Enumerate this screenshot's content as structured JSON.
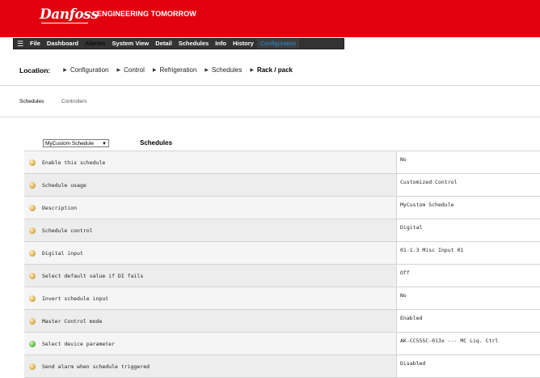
{
  "header": {
    "brand": "Danfoss",
    "tagline": "ENGINEERING TOMORROW",
    "brand_color": "#e2000f"
  },
  "menu": {
    "icon": "hamburger-menu-icon",
    "items": [
      "File",
      "Dashboard",
      "Alarms",
      "System View",
      "Detail",
      "Schedules",
      "Info",
      "History",
      "Configuration"
    ],
    "active": "Configuration"
  },
  "location": {
    "label": "Location:",
    "items": [
      "Configuration",
      "Control",
      "Refrigeration",
      "Schedules",
      "Rack / pack"
    ]
  },
  "subtabs": [
    "Schedules",
    "Controllers"
  ],
  "schedule_select": {
    "value": "MyCustom Schedule"
  },
  "section_title": "Schedules",
  "rows": [
    {
      "label": "Enable this schedule",
      "value": "No",
      "icon": "status-icon"
    },
    {
      "label": "Schedule usage",
      "value": "Customized Control",
      "icon": "status-icon"
    },
    {
      "label": "Description",
      "value": "MyCustom Schedule",
      "icon": "status-icon"
    },
    {
      "label": "Schedule control",
      "value": "Digital",
      "icon": "status-icon"
    },
    {
      "label": "Digital input",
      "value": "01-1.3 Misc Input 01",
      "icon": "status-icon"
    },
    {
      "label": "Select default value if DI fails",
      "value": "Off",
      "icon": "status-icon"
    },
    {
      "label": "Invert schedule input",
      "value": "No",
      "icon": "status-icon"
    },
    {
      "label": "Master Control mode",
      "value": "Enabled",
      "icon": "status-icon"
    },
    {
      "label": "Select device parameter",
      "value": "AK-CC55SC-013x --- MC Liq. Ctrl",
      "icon": "status-icon-green"
    },
    {
      "label": "Send alarm when schedule triggered",
      "value": "Disabled",
      "icon": "status-icon"
    }
  ]
}
